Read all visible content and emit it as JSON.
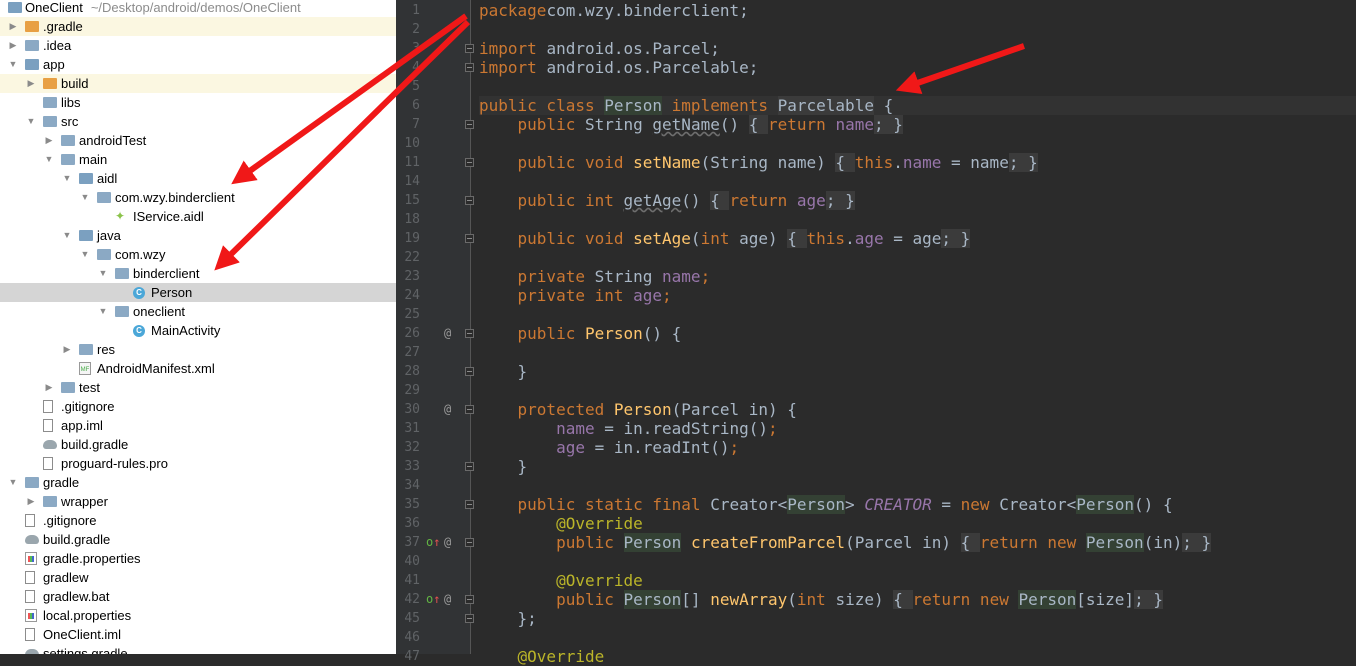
{
  "project": {
    "root_name": "OneClient",
    "root_path": "~/Desktop/android/demos/OneClient",
    "items": [
      {
        "label": ".gradle",
        "depth": 0,
        "toggle": "collapsed",
        "icon": "folder-orange",
        "highlight": true
      },
      {
        "label": ".idea",
        "depth": 0,
        "toggle": "collapsed",
        "icon": "folder"
      },
      {
        "label": "app",
        "depth": 0,
        "toggle": "expanded",
        "icon": "module"
      },
      {
        "label": "build",
        "depth": 1,
        "toggle": "collapsed",
        "icon": "folder-orange",
        "highlight": true
      },
      {
        "label": "libs",
        "depth": 1,
        "toggle": "",
        "icon": "folder"
      },
      {
        "label": "src",
        "depth": 1,
        "toggle": "expanded",
        "icon": "folder"
      },
      {
        "label": "androidTest",
        "depth": 2,
        "toggle": "collapsed",
        "icon": "folder"
      },
      {
        "label": "main",
        "depth": 2,
        "toggle": "expanded",
        "icon": "folder"
      },
      {
        "label": "aidl",
        "depth": 3,
        "toggle": "expanded",
        "icon": "folder-src"
      },
      {
        "label": "com.wzy.binderclient",
        "depth": 4,
        "toggle": "expanded",
        "icon": "package"
      },
      {
        "label": "IService.aidl",
        "depth": 5,
        "toggle": "",
        "icon": "android"
      },
      {
        "label": "java",
        "depth": 3,
        "toggle": "expanded",
        "icon": "folder-src"
      },
      {
        "label": "com.wzy",
        "depth": 4,
        "toggle": "expanded",
        "icon": "package"
      },
      {
        "label": "binderclient",
        "depth": 5,
        "toggle": "expanded",
        "icon": "package"
      },
      {
        "label": "Person",
        "depth": 6,
        "toggle": "",
        "icon": "class",
        "selected": true
      },
      {
        "label": "oneclient",
        "depth": 5,
        "toggle": "expanded",
        "icon": "package"
      },
      {
        "label": "MainActivity",
        "depth": 6,
        "toggle": "",
        "icon": "class"
      },
      {
        "label": "res",
        "depth": 3,
        "toggle": "collapsed",
        "icon": "folder"
      },
      {
        "label": "AndroidManifest.xml",
        "depth": 3,
        "toggle": "",
        "icon": "manifest"
      },
      {
        "label": "test",
        "depth": 2,
        "toggle": "collapsed",
        "icon": "folder"
      },
      {
        "label": ".gitignore",
        "depth": 1,
        "toggle": "",
        "icon": "file"
      },
      {
        "label": "app.iml",
        "depth": 1,
        "toggle": "",
        "icon": "file"
      },
      {
        "label": "build.gradle",
        "depth": 1,
        "toggle": "",
        "icon": "gradle"
      },
      {
        "label": "proguard-rules.pro",
        "depth": 1,
        "toggle": "",
        "icon": "file"
      },
      {
        "label": "gradle",
        "depth": 0,
        "toggle": "expanded",
        "icon": "folder"
      },
      {
        "label": "wrapper",
        "depth": 1,
        "toggle": "collapsed",
        "icon": "folder"
      },
      {
        "label": ".gitignore",
        "depth": 0,
        "toggle": "",
        "icon": "file"
      },
      {
        "label": "build.gradle",
        "depth": 0,
        "toggle": "",
        "icon": "gradle"
      },
      {
        "label": "gradle.properties",
        "depth": 0,
        "toggle": "",
        "icon": "properties"
      },
      {
        "label": "gradlew",
        "depth": 0,
        "toggle": "",
        "icon": "file"
      },
      {
        "label": "gradlew.bat",
        "depth": 0,
        "toggle": "",
        "icon": "file"
      },
      {
        "label": "local.properties",
        "depth": 0,
        "toggle": "",
        "icon": "properties"
      },
      {
        "label": "OneClient.iml",
        "depth": 0,
        "toggle": "",
        "icon": "file"
      },
      {
        "label": "settings.gradle",
        "depth": 0,
        "toggle": "",
        "icon": "gradle"
      }
    ]
  },
  "editor": {
    "current_line": "6",
    "lines": [
      {
        "n": "1",
        "tokens": [
          [
            "kw",
            "package"
          ],
          [
            "",
            "com.wzy.binderclient;"
          ]
        ]
      },
      {
        "n": "2",
        "tokens": []
      },
      {
        "n": "3",
        "fold": true,
        "tokens": [
          [
            "kw",
            "import "
          ],
          [
            "",
            "android.os.Parcel;"
          ]
        ]
      },
      {
        "n": "4",
        "fold": true,
        "tokens": [
          [
            "kw",
            "import "
          ],
          [
            "",
            "android.os.Parcelable;"
          ]
        ]
      },
      {
        "n": "5",
        "tokens": []
      },
      {
        "n": "6",
        "tokens": [
          [
            "kw",
            "public class "
          ],
          [
            "hlcls",
            "Person"
          ],
          [
            "kw",
            " implements "
          ],
          [
            "fb",
            "Parcelable"
          ],
          [
            "",
            " {"
          ]
        ]
      },
      {
        "n": "7",
        "fold": true,
        "tokens": [
          [
            "",
            "    "
          ],
          [
            "kw",
            "public "
          ],
          [
            "",
            "String "
          ],
          [
            "squig",
            "getName"
          ],
          [
            "",
            "() "
          ],
          [
            "fb",
            "{ "
          ],
          [
            "kw",
            "return "
          ],
          [
            "fld",
            "name"
          ],
          [
            "fb",
            "; }"
          ]
        ]
      },
      {
        "n": "10",
        "tokens": []
      },
      {
        "n": "11",
        "fold": true,
        "tokens": [
          [
            "",
            "    "
          ],
          [
            "kw",
            "public void "
          ],
          [
            "fn",
            "setName"
          ],
          [
            "",
            "(String name) "
          ],
          [
            "fb",
            "{ "
          ],
          [
            "kw",
            "this"
          ],
          [
            "",
            "."
          ],
          [
            "fld",
            "name"
          ],
          [
            "",
            " = name"
          ],
          [
            "fb",
            "; }"
          ]
        ]
      },
      {
        "n": "14",
        "tokens": []
      },
      {
        "n": "15",
        "fold": true,
        "tokens": [
          [
            "",
            "    "
          ],
          [
            "kw",
            "public int "
          ],
          [
            "squig",
            "getAge"
          ],
          [
            "",
            "() "
          ],
          [
            "fb",
            "{ "
          ],
          [
            "kw",
            "return "
          ],
          [
            "fld",
            "age"
          ],
          [
            "fb",
            "; }"
          ]
        ]
      },
      {
        "n": "18",
        "tokens": []
      },
      {
        "n": "19",
        "fold": true,
        "tokens": [
          [
            "",
            "    "
          ],
          [
            "kw",
            "public void "
          ],
          [
            "fn",
            "setAge"
          ],
          [
            "",
            "("
          ],
          [
            "kw",
            "int "
          ],
          [
            "",
            "age) "
          ],
          [
            "fb",
            "{ "
          ],
          [
            "kw",
            "this"
          ],
          [
            "",
            "."
          ],
          [
            "fld",
            "age"
          ],
          [
            "",
            " = age"
          ],
          [
            "fb",
            "; }"
          ]
        ]
      },
      {
        "n": "22",
        "tokens": []
      },
      {
        "n": "23",
        "tokens": [
          [
            "",
            "    "
          ],
          [
            "kw",
            "private "
          ],
          [
            "",
            "String "
          ],
          [
            "fld",
            "name"
          ],
          [
            "kw",
            ";"
          ]
        ]
      },
      {
        "n": "24",
        "tokens": [
          [
            "",
            "    "
          ],
          [
            "kw",
            "private int "
          ],
          [
            "fld",
            "age"
          ],
          [
            "kw",
            ";"
          ]
        ]
      },
      {
        "n": "25",
        "tokens": []
      },
      {
        "n": "26",
        "at": true,
        "fold": true,
        "tokens": [
          [
            "",
            "    "
          ],
          [
            "kw",
            "public "
          ],
          [
            "fn",
            "Person"
          ],
          [
            "",
            "() {"
          ]
        ]
      },
      {
        "n": "27",
        "tokens": []
      },
      {
        "n": "28",
        "fold": true,
        "tokens": [
          [
            "",
            "    }"
          ]
        ]
      },
      {
        "n": "29",
        "tokens": []
      },
      {
        "n": "30",
        "at": true,
        "fold": true,
        "tokens": [
          [
            "",
            "    "
          ],
          [
            "kw",
            "protected "
          ],
          [
            "fn",
            "Person"
          ],
          [
            "",
            "(Parcel in) {"
          ]
        ]
      },
      {
        "n": "31",
        "tokens": [
          [
            "",
            "        "
          ],
          [
            "fld",
            "name"
          ],
          [
            "",
            " = in.readString()"
          ],
          [
            "kw",
            ";"
          ]
        ]
      },
      {
        "n": "32",
        "tokens": [
          [
            "",
            "        "
          ],
          [
            "fld",
            "age"
          ],
          [
            "",
            " = in.readInt()"
          ],
          [
            "kw",
            ";"
          ]
        ]
      },
      {
        "n": "33",
        "fold": true,
        "tokens": [
          [
            "",
            "    }"
          ]
        ]
      },
      {
        "n": "34",
        "tokens": []
      },
      {
        "n": "35",
        "fold": true,
        "tokens": [
          [
            "",
            "    "
          ],
          [
            "kw",
            "public static final "
          ],
          [
            "",
            "Creator<"
          ],
          [
            "hlcls",
            "Person"
          ],
          [
            "",
            "> "
          ],
          [
            "stat",
            "CREATOR"
          ],
          [
            "",
            " = "
          ],
          [
            "kw",
            "new "
          ],
          [
            "",
            "Creator<"
          ],
          [
            "hlcls",
            "Person"
          ],
          [
            ">",
            "() {"
          ]
        ]
      },
      {
        "n": "36",
        "tokens": [
          [
            "",
            "        "
          ],
          [
            "ann",
            "@Override"
          ]
        ]
      },
      {
        "n": "37",
        "ovr": true,
        "at": true,
        "fold": true,
        "tokens": [
          [
            "",
            "        "
          ],
          [
            "kw",
            "public "
          ],
          [
            "hlcls",
            "Person"
          ],
          [
            "",
            " "
          ],
          [
            "fn",
            "createFromParcel"
          ],
          [
            "",
            "(Parcel in) "
          ],
          [
            "fb",
            "{ "
          ],
          [
            "kw",
            "return new "
          ],
          [
            "hlcls",
            "Person"
          ],
          [
            "",
            "(in)"
          ],
          [
            "fb",
            "; }"
          ]
        ]
      },
      {
        "n": "40",
        "tokens": []
      },
      {
        "n": "41",
        "tokens": [
          [
            "",
            "        "
          ],
          [
            "ann",
            "@Override"
          ]
        ]
      },
      {
        "n": "42",
        "ovr": true,
        "at": true,
        "fold": true,
        "tokens": [
          [
            "",
            "        "
          ],
          [
            "kw",
            "public "
          ],
          [
            "hlcls",
            "Person"
          ],
          [
            "",
            "[] "
          ],
          [
            "fn",
            "newArray"
          ],
          [
            "",
            "("
          ],
          [
            "kw",
            "int "
          ],
          [
            "",
            "size) "
          ],
          [
            "fb",
            "{ "
          ],
          [
            "kw",
            "return new "
          ],
          [
            "hlcls",
            "Person"
          ],
          [
            "",
            "[size]"
          ],
          [
            "fb",
            "; }"
          ]
        ]
      },
      {
        "n": "45",
        "fold": true,
        "tokens": [
          [
            "",
            "    };"
          ]
        ]
      },
      {
        "n": "46",
        "tokens": []
      },
      {
        "n": "47",
        "tokens": [
          [
            "",
            "    "
          ],
          [
            "ann",
            "@Override"
          ]
        ]
      }
    ]
  },
  "colors": {
    "arrow": "#f01818",
    "selected_row": "#d5d5d5",
    "editor_bg": "#2b2b2b"
  }
}
